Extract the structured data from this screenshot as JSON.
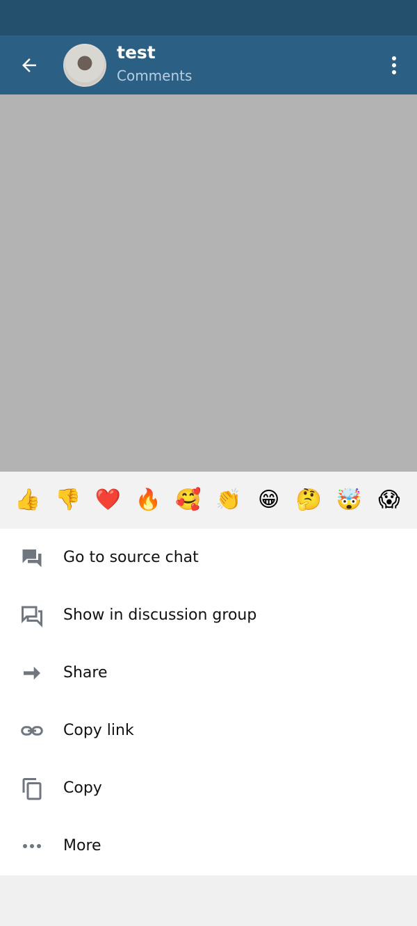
{
  "header": {
    "title": "test",
    "subtitle": "Comments"
  },
  "reactions": [
    {
      "emoji": "👍",
      "name": "thumbs-up"
    },
    {
      "emoji": "👎",
      "name": "thumbs-down"
    },
    {
      "emoji": "❤️",
      "name": "heart"
    },
    {
      "emoji": "🔥",
      "name": "fire"
    },
    {
      "emoji": "🥰",
      "name": "smiling-hearts"
    },
    {
      "emoji": "👏",
      "name": "clapping"
    },
    {
      "emoji": "😁",
      "name": "grinning"
    },
    {
      "emoji": "🤔",
      "name": "thinking"
    },
    {
      "emoji": "🤯",
      "name": "mind-blown"
    },
    {
      "emoji": "😱",
      "name": "screaming"
    }
  ],
  "menu": {
    "items": [
      {
        "label": "Go to source chat",
        "icon": "chat-icon"
      },
      {
        "label": "Show in discussion group",
        "icon": "discussion-icon"
      },
      {
        "label": "Share",
        "icon": "share-arrow-icon"
      },
      {
        "label": "Copy link",
        "icon": "link-icon"
      },
      {
        "label": "Copy",
        "icon": "copy-icon"
      },
      {
        "label": "More",
        "icon": "more-dots-icon"
      }
    ]
  },
  "colors": {
    "status_bar": "#24506e",
    "app_bar": "#2b5f84",
    "dim_overlay": "#b3b3b3",
    "reaction_bar": "#f2f2f2",
    "menu_icon": "#6f767e"
  }
}
